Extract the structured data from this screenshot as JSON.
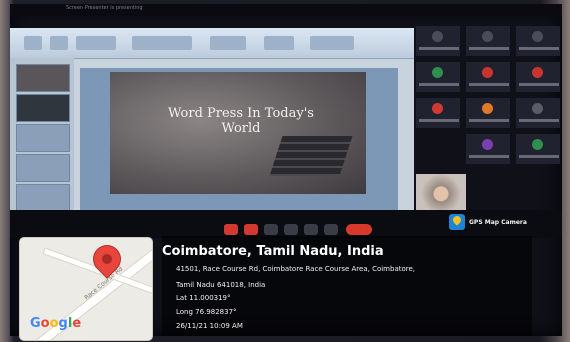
{
  "meeting": {
    "topbar_text": "Screen Presenter is presenting",
    "slide": {
      "title_line1": "Word Press In Today's",
      "title_line2": "World"
    }
  },
  "gps_badge": {
    "label": "GPS Map Camera",
    "icon": "map-pin-icon"
  },
  "location": {
    "title": "Coimbatore, Tamil Nadu, India",
    "address_line1": "41501, Race Course Rd, Coimbatore Race Course Area, Coimbatore,",
    "address_line2": "Tamil Nadu 641018, India",
    "lat": "Lat 11.000319°",
    "long": "Long 76.982837°",
    "datetime": "26/11/21 10:09 AM"
  },
  "map": {
    "brand": "Google",
    "road_label": "Race Course Rd",
    "pin_color": "#e8453c"
  },
  "colors": {
    "end_call": "#d8392d",
    "gps_icon": "#1e84d6"
  }
}
